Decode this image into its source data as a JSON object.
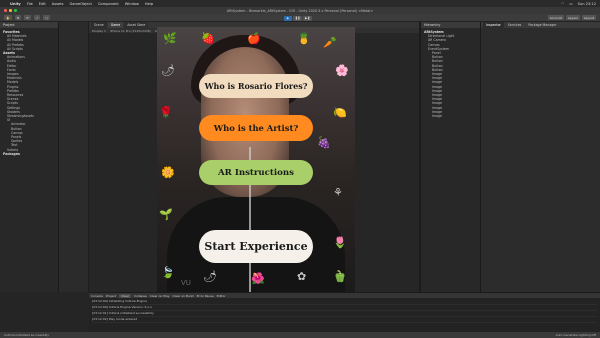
{
  "menubar": {
    "app": "Unity",
    "items": [
      "File",
      "Edit",
      "Assets",
      "GameObject",
      "Component",
      "Window",
      "Help"
    ],
    "clock": "Sun 23:12"
  },
  "window": {
    "title": "ARtSystem - Bismarkie_ARtSystem - iOS - Unity 2020.3.x Personal (Personal) <Metal>"
  },
  "toolbar": {
    "account": "Account",
    "layers": "Layers",
    "layout": "Layout"
  },
  "hierarchy": {
    "tab": "Project",
    "items": [
      {
        "label": "Favorites",
        "level": 0
      },
      {
        "label": "All Materials",
        "level": 1
      },
      {
        "label": "All Models",
        "level": 1
      },
      {
        "label": "All Prefabs",
        "level": 1
      },
      {
        "label": "All Scripts",
        "level": 1
      },
      {
        "label": "Assets",
        "level": 0
      },
      {
        "label": "Animations",
        "level": 1
      },
      {
        "label": "Audio",
        "level": 1
      },
      {
        "label": "Editor",
        "level": 1
      },
      {
        "label": "Fonts",
        "level": 1
      },
      {
        "label": "Images",
        "level": 1
      },
      {
        "label": "Materials",
        "level": 1
      },
      {
        "label": "Models",
        "level": 1
      },
      {
        "label": "Plugins",
        "level": 1
      },
      {
        "label": "Prefabs",
        "level": 1
      },
      {
        "label": "Resources",
        "level": 1
      },
      {
        "label": "Scenes",
        "level": 1
      },
      {
        "label": "Scripts",
        "level": 1
      },
      {
        "label": "Settings",
        "level": 1
      },
      {
        "label": "Shaders",
        "level": 1
      },
      {
        "label": "StreamingAssets",
        "level": 1
      },
      {
        "label": "UI",
        "level": 1
      },
      {
        "label": "Animator",
        "level": 2
      },
      {
        "label": "Button",
        "level": 2
      },
      {
        "label": "Canvas",
        "level": 2
      },
      {
        "label": "Panels",
        "level": 2
      },
      {
        "label": "Sprites",
        "level": 2
      },
      {
        "label": "Text",
        "level": 2
      },
      {
        "label": "Vuforia",
        "level": 1
      },
      {
        "label": "Packages",
        "level": 0
      }
    ]
  },
  "viewport": {
    "tabs": [
      "Scene",
      "Game",
      "Asset Store"
    ],
    "active_tab": "Game",
    "bar": [
      "Display 1",
      "iPhone 11 Pro (1125x2436)",
      "Scale 0.4x",
      "Maximize On Play",
      "Mute Audio",
      "Stats",
      "Gizmos"
    ]
  },
  "ar_menu": {
    "buttons": [
      {
        "label": "Who is Rosario Flores?",
        "color": "#f1dcc0"
      },
      {
        "label": "Who is the Artist?",
        "color": "#ff8a1f"
      },
      {
        "label": "AR Instructions",
        "color": "#a9cf6a"
      },
      {
        "label": "Start Experience",
        "color": "#f5f1ea"
      }
    ],
    "watermark": "VU"
  },
  "hierarchy_right": {
    "tab": "Hierarchy",
    "items": [
      "ARtSystem",
      "Directional Light",
      "AR Camera",
      "Canvas",
      "EventSystem",
      "Panel",
      "Button",
      "Button",
      "Button",
      "Button",
      "Image",
      "Image",
      "Image",
      "Image",
      "Image",
      "Image",
      "Image",
      "Image",
      "Image",
      "Image",
      "Image"
    ]
  },
  "inspector": {
    "tabs": [
      "Inspector",
      "Services",
      "Package Manager"
    ],
    "active_tab": "Inspector"
  },
  "console": {
    "tabs": [
      "Console",
      "Project"
    ],
    "buttons": [
      "Clear",
      "Collapse",
      "Clear on Play",
      "Clear on Build",
      "Error Pause",
      "Editor"
    ],
    "logs": [
      "[23:12:00] Initializing Vuforia Engine",
      "[23:12:00] Vuforia Engine Version: 9.x.x",
      "[23:12:01] Vuforia initialized successfully",
      "[23:12:02] Play mode entered"
    ]
  },
  "status": {
    "left": "Vuforia initialized successfully",
    "right": "Auto Generate Lighting Off"
  }
}
